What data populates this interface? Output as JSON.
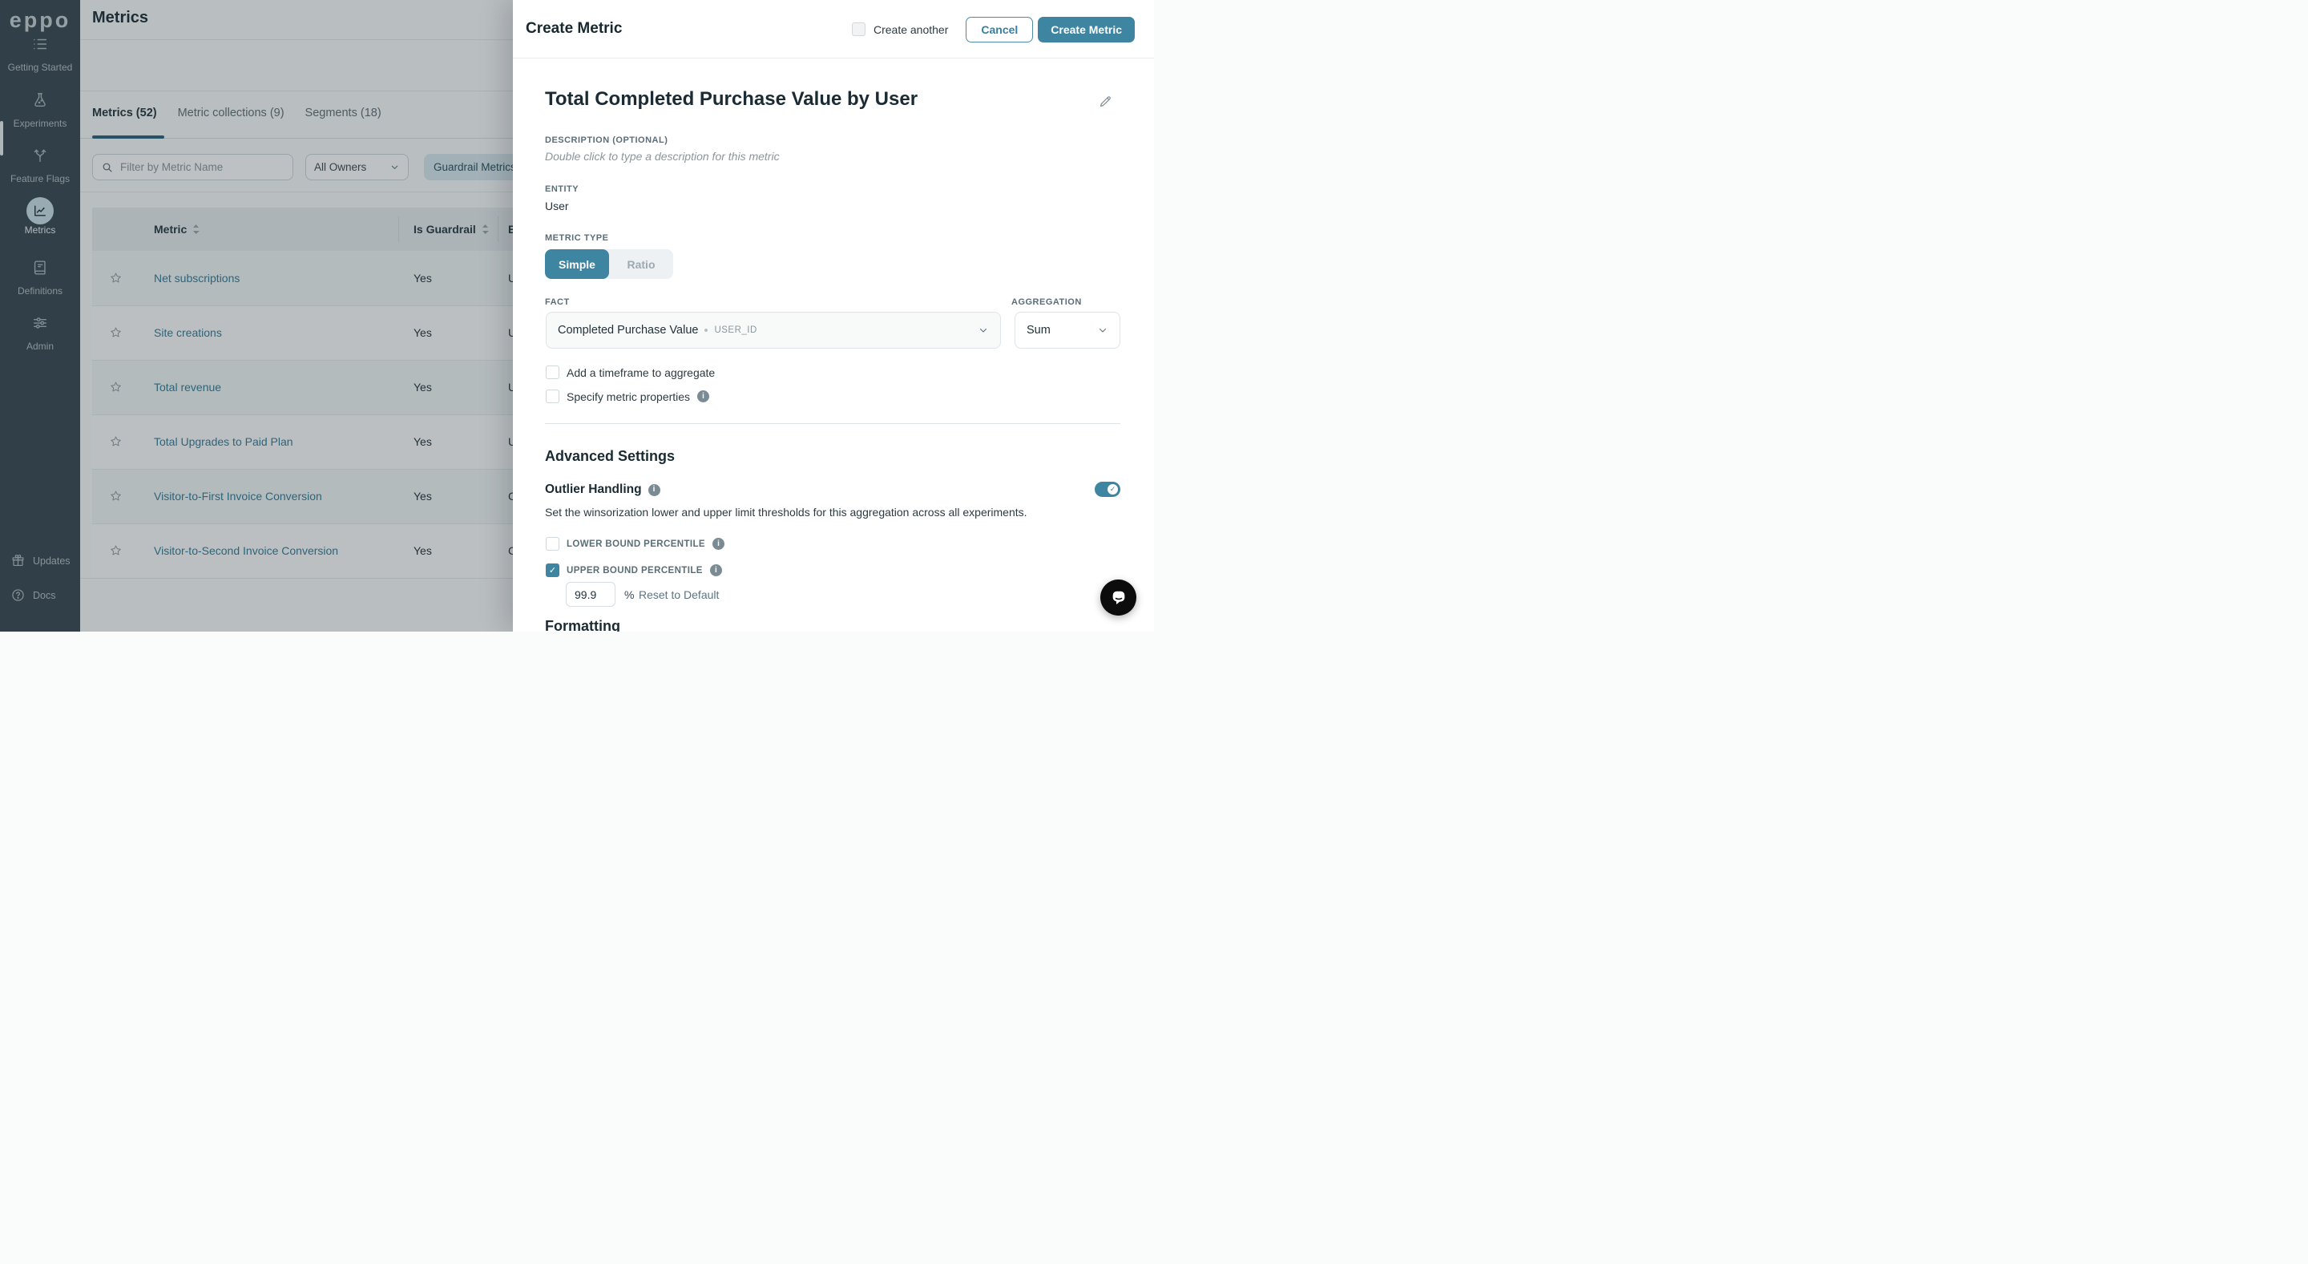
{
  "sidebar": {
    "logo": "eppo",
    "items": [
      {
        "label": "Getting Started",
        "icon": "list-icon",
        "active": false
      },
      {
        "label": "Experiments",
        "icon": "flask-icon",
        "active": false
      },
      {
        "label": "Feature Flags",
        "icon": "branch-icon",
        "active": false
      },
      {
        "label": "Metrics",
        "icon": "chart-icon",
        "active": true
      },
      {
        "label": "Definitions",
        "icon": "book-icon",
        "active": false
      },
      {
        "label": "Admin",
        "icon": "sliders-icon",
        "active": false
      }
    ],
    "footer_items": [
      {
        "label": "Updates",
        "icon": "gift-icon"
      },
      {
        "label": "Docs",
        "icon": "help-icon"
      }
    ]
  },
  "metrics_page": {
    "title": "Metrics",
    "tabs": [
      {
        "label": "Metrics (52)",
        "active": true
      },
      {
        "label": "Metric collections (9)",
        "active": false
      },
      {
        "label": "Segments (18)",
        "active": false
      }
    ],
    "filters": {
      "search_placeholder": "Filter by Metric Name",
      "owner_filter": "All Owners",
      "guardrail_filter": "Guardrail Metrics"
    },
    "table": {
      "columns": [
        {
          "label": "Metric"
        },
        {
          "label": "Is Guardrail"
        },
        {
          "label": "E"
        }
      ],
      "rows": [
        {
          "name": "Net subscriptions",
          "is_guardrail": "Yes",
          "entity": "U"
        },
        {
          "name": "Site creations",
          "is_guardrail": "Yes",
          "entity": "U"
        },
        {
          "name": "Total revenue",
          "is_guardrail": "Yes",
          "entity": "U"
        },
        {
          "name": "Total Upgrades to Paid Plan",
          "is_guardrail": "Yes",
          "entity": "U"
        },
        {
          "name": "Visitor-to-First Invoice Conversion",
          "is_guardrail": "Yes",
          "entity": "C"
        },
        {
          "name": "Visitor-to-Second Invoice Conversion",
          "is_guardrail": "Yes",
          "entity": "C"
        }
      ]
    }
  },
  "panel": {
    "title": "Create Metric",
    "create_another_label": "Create another",
    "create_another_checked": false,
    "cancel_label": "Cancel",
    "submit_label": "Create Metric",
    "metric_name": "Total Completed Purchase Value by User",
    "description_label": "DESCRIPTION (OPTIONAL)",
    "description_placeholder": "Double click to type a description for this metric",
    "entity_label": "ENTITY",
    "entity_value": "User",
    "metric_type_label": "METRIC TYPE",
    "metric_type_options": [
      {
        "label": "Simple",
        "active": true
      },
      {
        "label": "Ratio",
        "active": false
      }
    ],
    "fact_label": "FACT",
    "fact_value": "Completed Purchase Value",
    "fact_entity_key": "USER_ID",
    "aggregation_label": "AGGREGATION",
    "aggregation_value": "Sum",
    "timeframe_checkbox_label": "Add a timeframe to aggregate",
    "timeframe_checked": false,
    "properties_checkbox_label": "Specify metric properties",
    "properties_checked": false,
    "advanced_settings_title": "Advanced Settings",
    "outlier_title": "Outlier Handling",
    "outlier_enabled": true,
    "outlier_description": "Set the winsorization lower and upper limit thresholds for this aggregation across all experiments.",
    "lower_bound_label": "LOWER BOUND PERCENTILE",
    "lower_bound_checked": false,
    "upper_bound_label": "UPPER BOUND PERCENTILE",
    "upper_bound_checked": true,
    "upper_bound_value": "99.9",
    "percent_sign": "%",
    "reset_label": "Reset to Default",
    "formatting_title": "Formatting",
    "check_glyph": "✓"
  },
  "colors": {
    "accent_teal": "#3D85A1",
    "sidebar_bg": "#37474F",
    "link_teal": "#2F7B99",
    "tab_indicator": "#26607A",
    "backdrop": "rgba(38,50,56,0.30)",
    "active_nav_circle": "#CBDFE7"
  }
}
